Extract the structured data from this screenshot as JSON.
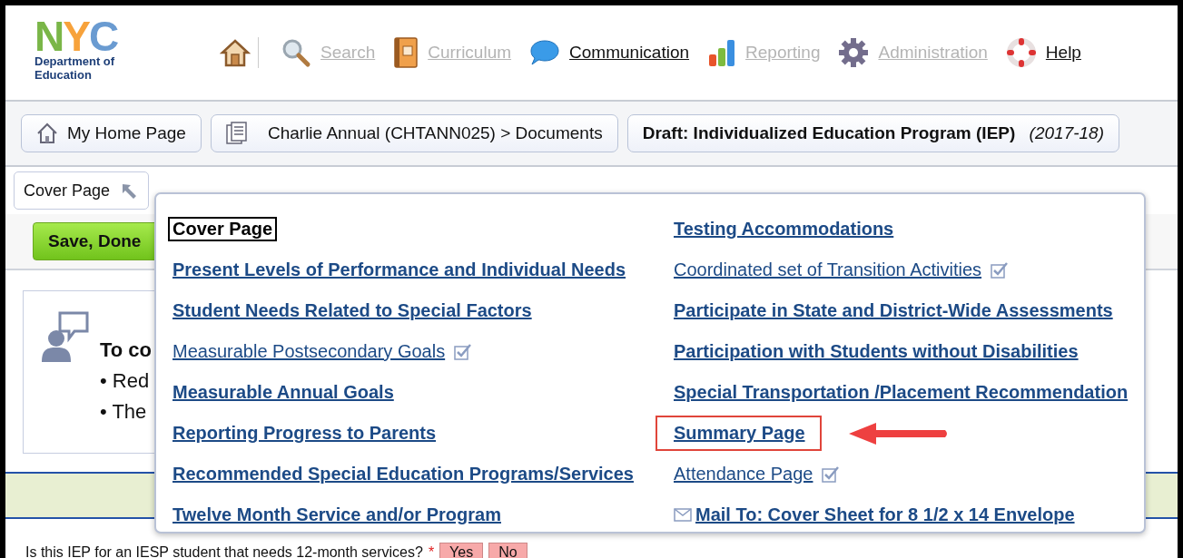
{
  "logo": {
    "letters": "NYC",
    "line_1": "Department of",
    "line_2": "Education"
  },
  "nav": [
    {
      "kind": "home",
      "disabled": false
    },
    {
      "kind": "search",
      "label": "Search",
      "disabled": true
    },
    {
      "kind": "book",
      "label": "Curriculum",
      "disabled": true
    },
    {
      "kind": "chat",
      "label": "Communication",
      "disabled": false
    },
    {
      "kind": "chart",
      "label": "Reporting",
      "disabled": true
    },
    {
      "kind": "gear",
      "label": "Administration",
      "disabled": true
    },
    {
      "kind": "help",
      "label": "Help",
      "disabled": false
    }
  ],
  "breadcrumbs": [
    {
      "kind": "home",
      "label": "My Home Page"
    },
    {
      "kind": "doc",
      "label": "Charlie Annual (CHTANN025) > Documents"
    },
    {
      "kind": "current",
      "label": "Draft: Individualized Education Program (IEP)",
      "year": "(2017-18)"
    }
  ],
  "section_button": {
    "label": "Cover Page"
  },
  "save_button": {
    "label": "Save, Done"
  },
  "instructions": {
    "title": "To co",
    "bullets": [
      "• Red",
      "• The"
    ]
  },
  "question": {
    "label": "Is this IEP for an IESP student that needs 12-month services?",
    "required_mark": "*",
    "options": [
      {
        "label": "Yes",
        "selected": false
      },
      {
        "label": "No",
        "selected": false
      }
    ]
  },
  "menu": {
    "columns": [
      [
        {
          "label": "Cover Page",
          "bold": true,
          "checked": false,
          "selected": true,
          "kind": "link",
          "annotated": false
        },
        {
          "label": "Present Levels of Performance and Individual Needs",
          "bold": true,
          "checked": false,
          "selected": false,
          "kind": "link",
          "annotated": false
        },
        {
          "label": "Student Needs Related to Special Factors",
          "bold": true,
          "checked": false,
          "selected": false,
          "kind": "link",
          "annotated": false
        },
        {
          "label": "Measurable Postsecondary Goals",
          "bold": false,
          "checked": true,
          "selected": false,
          "kind": "link",
          "annotated": false
        },
        {
          "label": "Measurable Annual Goals",
          "bold": true,
          "checked": false,
          "selected": false,
          "kind": "link",
          "annotated": false
        },
        {
          "label": "Reporting Progress to Parents",
          "bold": true,
          "checked": false,
          "selected": false,
          "kind": "link",
          "annotated": false
        },
        {
          "label": "Recommended Special Education Programs/Services",
          "bold": true,
          "checked": false,
          "selected": false,
          "kind": "link",
          "annotated": false
        },
        {
          "label": "Twelve Month Service and/or Program",
          "bold": true,
          "checked": false,
          "selected": false,
          "kind": "link",
          "annotated": false
        }
      ],
      [
        {
          "label": "Testing Accommodations",
          "bold": true,
          "checked": false,
          "selected": false,
          "kind": "link",
          "annotated": false
        },
        {
          "label": "Coordinated set of Transition Activities",
          "bold": false,
          "checked": true,
          "selected": false,
          "kind": "link",
          "annotated": false
        },
        {
          "label": "Participate in State and District-Wide Assessments",
          "bold": true,
          "checked": false,
          "selected": false,
          "kind": "link",
          "annotated": false
        },
        {
          "label": "Participation with Students without Disabilities",
          "bold": true,
          "checked": false,
          "selected": false,
          "kind": "link",
          "annotated": false
        },
        {
          "label": "Special Transportation /Placement Recommendation",
          "bold": true,
          "checked": false,
          "selected": false,
          "kind": "link",
          "annotated": false
        },
        {
          "label": "Summary Page",
          "bold": true,
          "checked": false,
          "selected": false,
          "kind": "link",
          "annotated": true
        },
        {
          "label": "Attendance Page",
          "bold": false,
          "checked": true,
          "selected": false,
          "kind": "link",
          "annotated": false
        },
        {
          "label": "Mail To: Cover Sheet for 8 1/2 x 14 Envelope",
          "bold": true,
          "checked": false,
          "selected": false,
          "kind": "mail",
          "annotated": false
        }
      ]
    ]
  }
}
